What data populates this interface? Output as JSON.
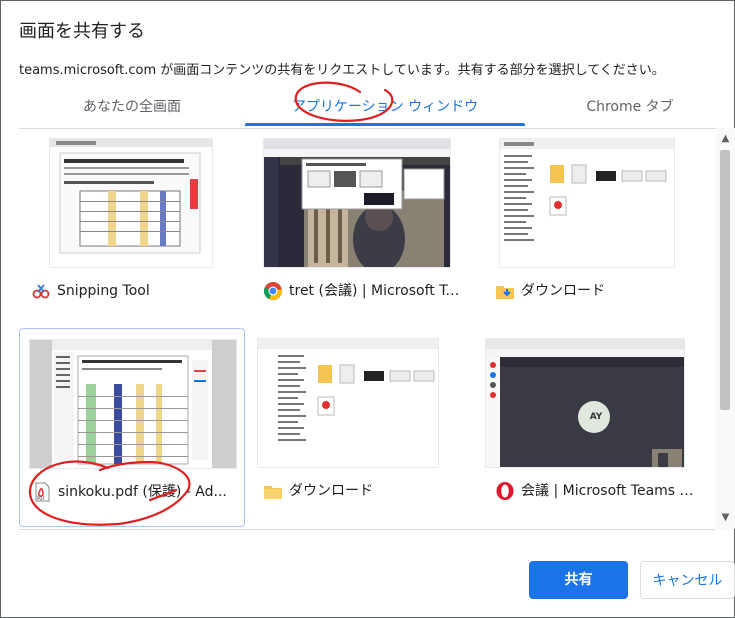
{
  "dialog": {
    "title": "画面を共有する",
    "description": "teams.microsoft.com が画面コンテンツの共有をリクエストしています。共有する部分を選択してください。"
  },
  "tabs": [
    {
      "label": "あなたの全画面",
      "active": false
    },
    {
      "label": "アプリケーション ウィンドウ",
      "active": true
    },
    {
      "label": "Chrome タブ",
      "active": false
    }
  ],
  "windows": [
    {
      "label": "Snipping Tool",
      "icon": "snipping-tool-icon"
    },
    {
      "label": "tret (会議) | Microsoft Tea...",
      "icon": "chrome-icon"
    },
    {
      "label": "ダウンロード",
      "icon": "downloads-folder-icon"
    },
    {
      "label": "sinkoku.pdf (保護) - Ad...",
      "icon": "pdf-file-icon"
    },
    {
      "label": "ダウンロード",
      "icon": "folder-icon"
    },
    {
      "label": "会議 | Microsoft Teams -...",
      "icon": "opera-icon"
    }
  ],
  "thumb_text": {
    "avatar": "AY"
  },
  "buttons": {
    "share": "共有",
    "cancel": "キャンセル"
  },
  "colors": {
    "accent": "#1a73e8",
    "annotation": "#e02020"
  }
}
